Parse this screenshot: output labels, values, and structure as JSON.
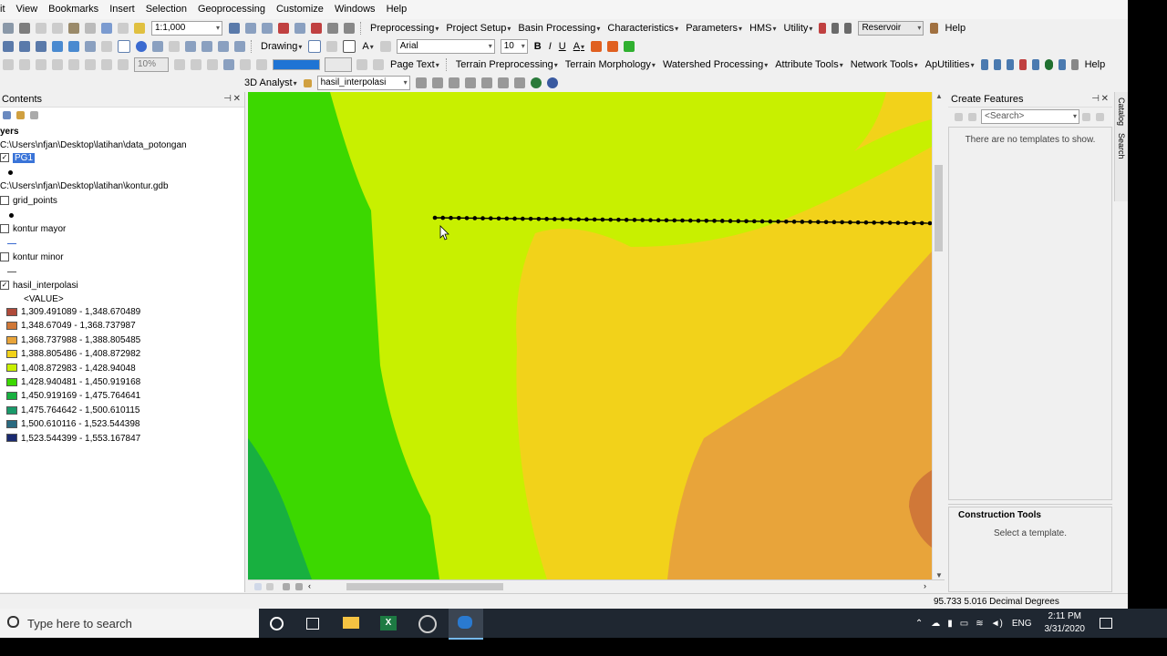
{
  "menus": [
    "it",
    "View",
    "Bookmarks",
    "Insert",
    "Selection",
    "Geoprocessing",
    "Customize",
    "Windows",
    "Help"
  ],
  "toolbar1": {
    "scale": "1:1,000",
    "menus": [
      "Preprocessing",
      "Project Setup",
      "Basin Processing",
      "Characteristics",
      "Parameters",
      "HMS",
      "Utility"
    ],
    "reservoir": "Reservoir",
    "help": "Help"
  },
  "toolbar2": {
    "drawing": "Drawing",
    "font": "Arial",
    "font_size": "10"
  },
  "toolbar3": {
    "zoom": "10%",
    "page_text": "Page Text",
    "menus": [
      "Terrain Preprocessing",
      "Terrain Morphology",
      "Watershed Processing",
      "Attribute Tools",
      "Network Tools",
      "ApUtilities"
    ],
    "help": "Help"
  },
  "toolbar4": {
    "analyst": "3D Analyst",
    "layer": "hasil_interpolasi"
  },
  "toc": {
    "title": "Contents",
    "layers_header": "yers",
    "path1": "C:\\Users\\nfjan\\Desktop\\latihan\\data_potongan",
    "layer_pg1": "PG1",
    "path2": "C:\\Users\\nfjan\\Desktop\\latihan\\kontur.gdb",
    "grid_points": "grid_points",
    "kontur_mayor": "kontur mayor",
    "kontur_minor": "kontur minor",
    "hasil": "hasil_interpolasi",
    "value": "<VALUE>",
    "legend": [
      {
        "label": "1,309.491089 - 1,348.670489",
        "color": "#b04a3a"
      },
      {
        "label": "1,348.67049 - 1,368.737987",
        "color": "#d07838"
      },
      {
        "label": "1,368.737988 - 1,388.805485",
        "color": "#e8a43a"
      },
      {
        "label": "1,388.805486 - 1,408.872982",
        "color": "#f2d21a"
      },
      {
        "label": "1,408.872983 - 1,428.94048",
        "color": "#c8f000"
      },
      {
        "label": "1,428.940481 - 1,450.919168",
        "color": "#3cd800"
      },
      {
        "label": "1,450.919169 - 1,475.764641",
        "color": "#18b040"
      },
      {
        "label": "1,475.764642 - 1,500.610115",
        "color": "#1a9a6a"
      },
      {
        "label": "1,500.610116 - 1,523.544398",
        "color": "#2a6a80"
      },
      {
        "label": "1,523.544399 - 1,553.167847",
        "color": "#1a2a70"
      }
    ]
  },
  "create_features": {
    "title": "Create Features",
    "search_placeholder": "<Search>",
    "empty": "There are no templates to show.",
    "construction": "Construction Tools",
    "select": "Select a template."
  },
  "side_tabs": [
    "Catalog",
    "Search"
  ],
  "status": {
    "coords": "95.733  5.016 Decimal Degrees"
  },
  "taskbar": {
    "search": "Type here to search",
    "lang": "ENG",
    "time": "2:11 PM",
    "date": "3/31/2020"
  }
}
